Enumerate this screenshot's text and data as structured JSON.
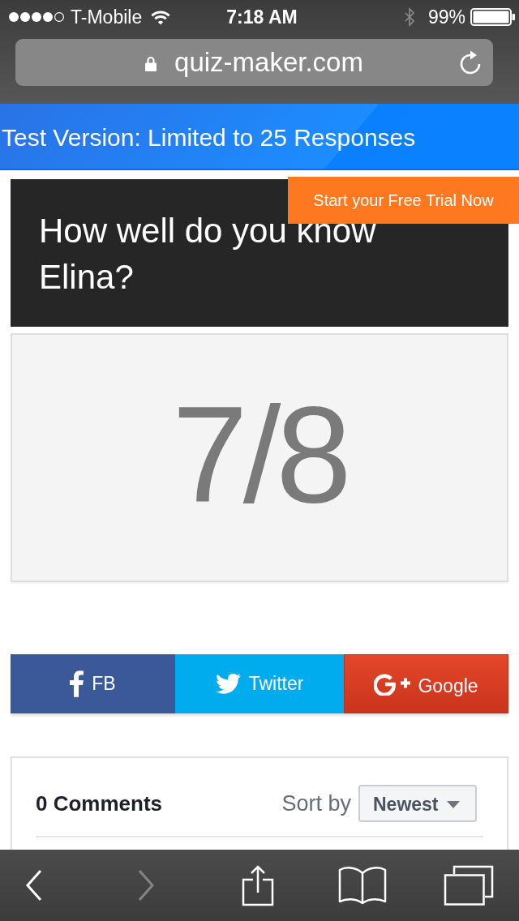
{
  "status_bar": {
    "carrier": "T-Mobile",
    "time": "7:18 AM",
    "battery": "99%"
  },
  "address_bar": {
    "url": "quiz-maker.com",
    "secure": true
  },
  "banner": {
    "text": "Test Version: Limited to 25 Responses"
  },
  "trial_button": {
    "label": "Start your Free Trial Now"
  },
  "quiz": {
    "title": "How well do you know Elina?",
    "score": "7/8"
  },
  "share_buttons": [
    {
      "kind": "facebook",
      "label": "FB"
    },
    {
      "kind": "twitter",
      "label": "Twitter"
    },
    {
      "kind": "google",
      "label": "Google"
    }
  ],
  "comments": {
    "count": "0 Comments",
    "sort_label": "Sort by",
    "sort_value": "Newest"
  },
  "toolbar": [
    {
      "kind": "back",
      "disabled": false
    },
    {
      "kind": "forward",
      "disabled": true
    },
    {
      "kind": "share",
      "disabled": false
    },
    {
      "kind": "bookmarks",
      "disabled": false
    },
    {
      "kind": "tabs",
      "disabled": false
    }
  ]
}
